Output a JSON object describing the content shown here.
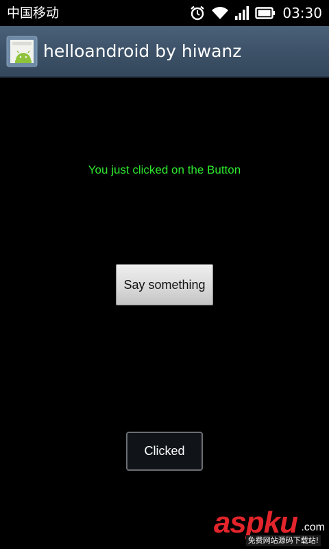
{
  "status_bar": {
    "carrier": "中国移动",
    "time": "03:30",
    "icons": [
      "alarm-icon",
      "wifi-icon",
      "signal-icon",
      "battery-icon"
    ]
  },
  "action_bar": {
    "title": "helloandroid by hiwanz",
    "icon": "android-app-icon"
  },
  "content": {
    "message": "You just clicked on the Button",
    "button_label": "Say something",
    "toast": "Clicked"
  },
  "watermark": {
    "main": "aspku",
    "suffix": ".com",
    "sub": "免费网站源码下载站!"
  },
  "colors": {
    "message": "#2ee82e",
    "action_bar": "#3d5268",
    "watermark": "#e3242b"
  }
}
